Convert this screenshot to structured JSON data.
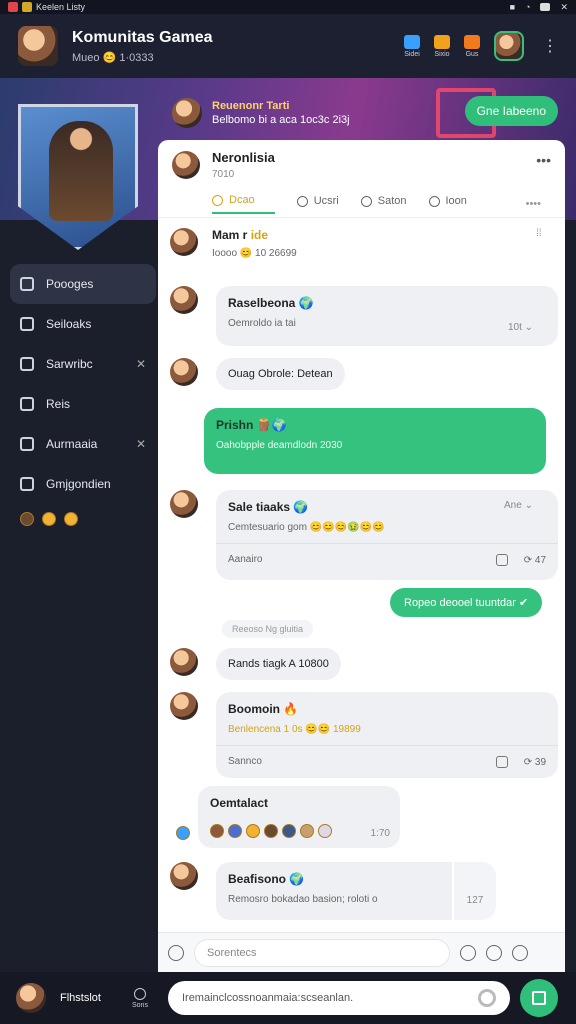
{
  "status": {
    "app_name": "Keelen Listy"
  },
  "header": {
    "title": "Komunitas Gamea",
    "subtitle": "Mueo 😊 1·0333",
    "actions": [
      "Sidei",
      "Sixio",
      "Gus"
    ]
  },
  "banner": {
    "name": "Reuenonr Tarti",
    "subtitle": "Belbomo bi a aca 1oc3c 2i3j",
    "join_label": "Gne Iabeeno"
  },
  "sidebar": {
    "items": [
      {
        "label": "Poooges",
        "active": true
      },
      {
        "label": "Seiloaks"
      },
      {
        "label": "Sarwribc"
      },
      {
        "label": "Reis"
      },
      {
        "label": "Aurmaaia"
      },
      {
        "label": "Gmjgondien"
      }
    ]
  },
  "panel": {
    "name": "Neronlisia",
    "sub": "7010",
    "tabs": [
      "Dcao",
      "Ucsri",
      "Saton",
      "Ioon"
    ],
    "messages": {
      "m1": {
        "name": "Mam r",
        "tag": "ide",
        "sub": "Ioooo 😊 10 26699"
      },
      "m2": {
        "name": "Raselbeona 🌍",
        "sub": "Oemroldo ia tai",
        "meta": "10t ⌄"
      },
      "m3": {
        "text": "Ouag Obrole: Detean"
      },
      "m4": {
        "name": "Prishn 🪵🌍",
        "sub": "Oahobpple deamdlodn 2030"
      },
      "m5": {
        "name": "Sale tiaaks 🌍",
        "sub": "Cemtesuario gom 😊😊😊🤢😊😊",
        "meta": "Ane ⌄",
        "footer": "Aanairo",
        "count": "⟳ 47"
      },
      "m6": {
        "text": "Ropeo deooel tuuntdar ✔"
      },
      "m7": {
        "text": "Reeoso Ng gluitia"
      },
      "m8": {
        "text": "Rands tiagk  A 10800"
      },
      "m9": {
        "name": "Boomoin 🔥",
        "sub": "Benlencena 1 0s 😊😊 19899",
        "footer": "Sannco",
        "count": "⟳ 39"
      },
      "m10": {
        "name": "Oemtalact",
        "time": "1:70"
      },
      "m11": {
        "name": "Beafisono 🌍",
        "sub": "Remosro bokadao basion; roloti o",
        "meta": "127"
      }
    },
    "composer_placeholder": "Sorentecs"
  },
  "bottom": {
    "name": "Flhstslot",
    "info_label": "Sons",
    "input_placeholder": "Iremainclcossnoanmaia:scseanlan."
  },
  "colors": {
    "accent": "#2fbf7a",
    "panel": "#ffffff",
    "sidebar": "#1b1e2b"
  }
}
